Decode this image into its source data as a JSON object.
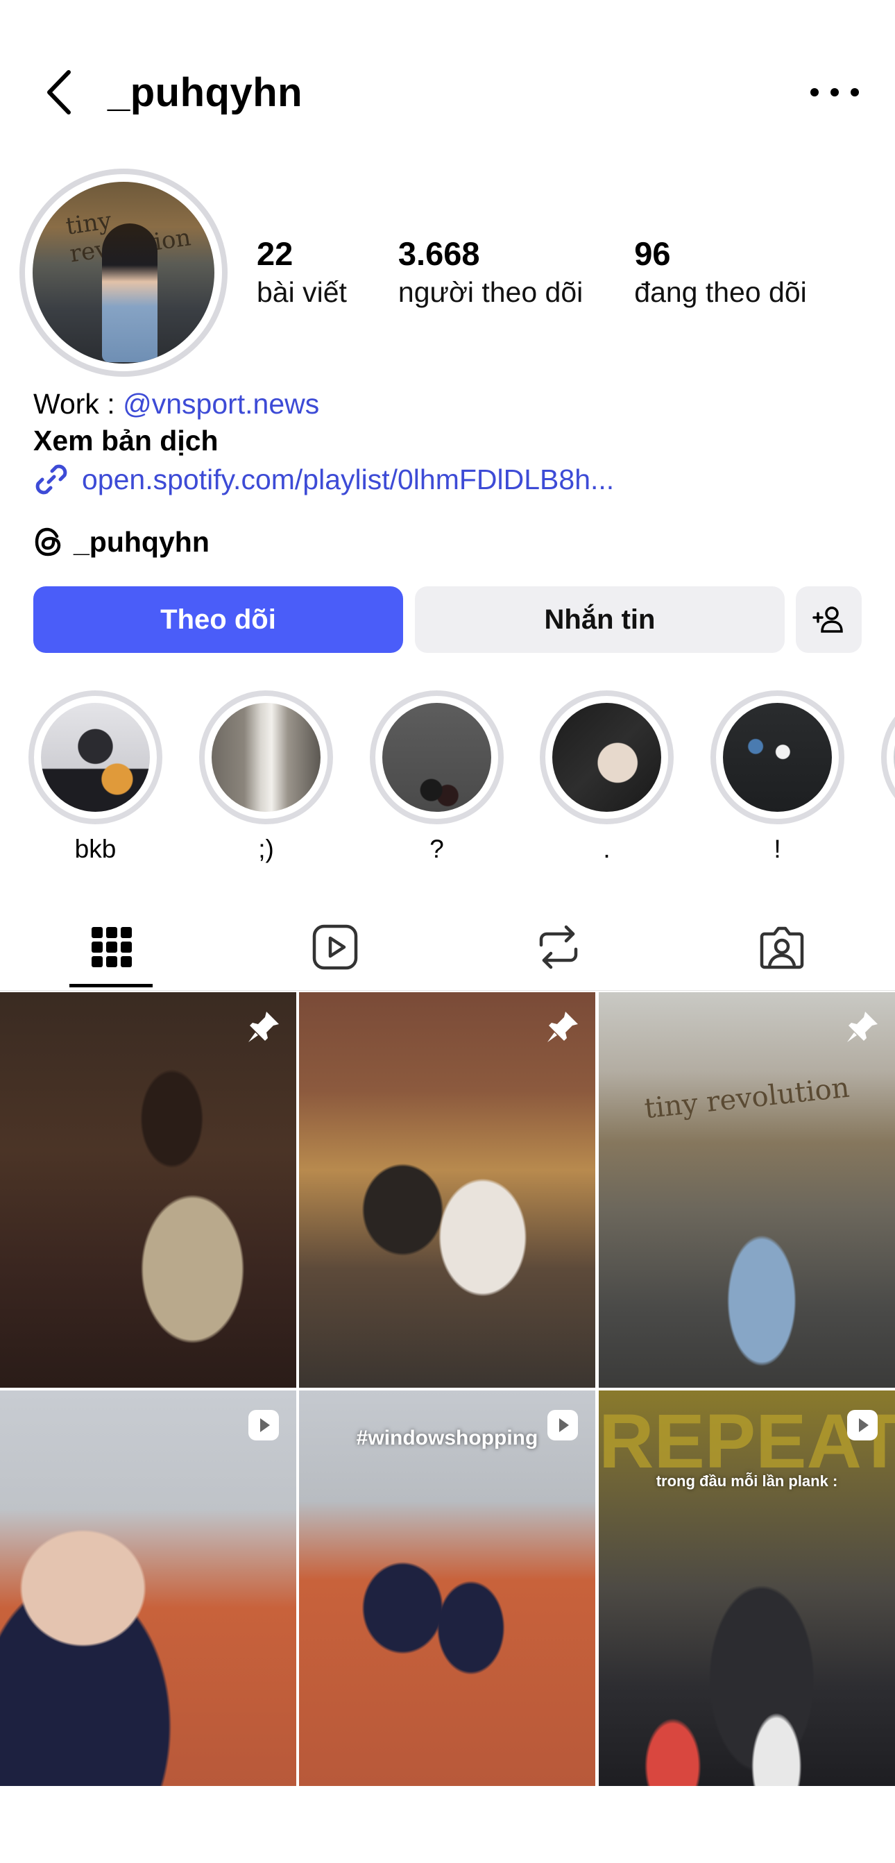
{
  "header": {
    "username": "_puhqyhn"
  },
  "stats": [
    {
      "value": "22",
      "label": "bài viết"
    },
    {
      "value": "3.668",
      "label": "người theo dõi"
    },
    {
      "value": "96",
      "label": "đang theo dõi"
    }
  ],
  "bio": {
    "work_prefix": "Work : ",
    "work_link": "@vnsport.news",
    "translate": "Xem bản dịch",
    "url": "open.spotify.com/playlist/0lhmFDlDLB8h...",
    "threads": "_puhqyhn"
  },
  "buttons": {
    "follow": "Theo dõi",
    "message": "Nhắn tin"
  },
  "highlights": [
    {
      "label": "bkb"
    },
    {
      "label": ";)"
    },
    {
      "label": "?"
    },
    {
      "label": "."
    },
    {
      "label": "!"
    }
  ],
  "tabs": [
    {
      "icon": "grid-icon",
      "active": true
    },
    {
      "icon": "reels-icon",
      "active": false
    },
    {
      "icon": "repost-icon",
      "active": false
    },
    {
      "icon": "tagged-icon",
      "active": false
    }
  ],
  "posts": [
    {
      "type": "pinned",
      "badge_icon": "pin-icon"
    },
    {
      "type": "pinned",
      "badge_icon": "pin-icon"
    },
    {
      "type": "pinned",
      "badge_icon": "pin-icon",
      "sign_text": "tiny revolution"
    },
    {
      "type": "reel",
      "badge_icon": "reel-icon"
    },
    {
      "type": "reel",
      "badge_icon": "reel-icon",
      "caption": "#windowshopping"
    },
    {
      "type": "reel",
      "badge_icon": "reel-icon",
      "caption": "trong đầu mỗi lần plank :",
      "sign_text": "REPEAT"
    }
  ],
  "colors": {
    "accent": "#4a5df9",
    "link": "#3d4bd6",
    "secondary_button": "#efeff2"
  }
}
